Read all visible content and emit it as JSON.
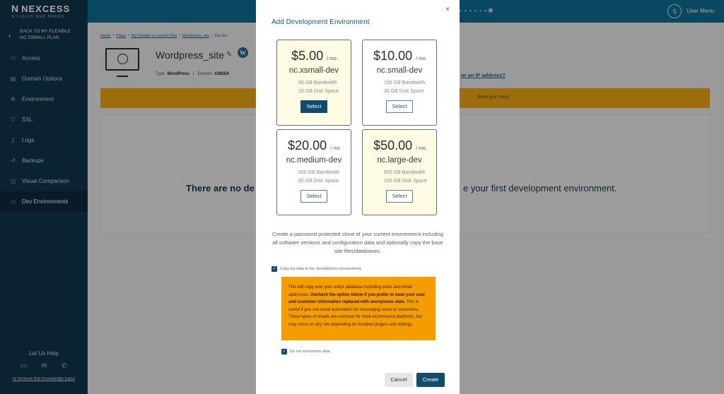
{
  "brand": {
    "name": "NEXCESS",
    "tagline": "A LIQUID WEB BRAND"
  },
  "sidebar": {
    "back_label": "BACK TO MY FLEXIBLE NC.XSMALL PLAN",
    "items": [
      {
        "label": "Access",
        "icon": "person-icon"
      },
      {
        "label": "Domain Options",
        "icon": "document-icon"
      },
      {
        "label": "Environment",
        "icon": "gear-icon"
      },
      {
        "label": "SSL",
        "icon": "shield-icon"
      },
      {
        "label": "Logs",
        "icon": "file-icon"
      },
      {
        "label": "Backups",
        "icon": "database-icon"
      },
      {
        "label": "Visual Comparison",
        "icon": "compare-icon"
      },
      {
        "label": "Dev Environments",
        "icon": "monitor-icon"
      }
    ],
    "help_title": "Let Us Help",
    "help_link": "or browse the knowledge base"
  },
  "topbar": {
    "masked": "• • • • • •",
    "avatar_initial": "S",
    "user_menu": "User Menu"
  },
  "breadcrumb": [
    "Home",
    "Plans",
    "My Flexible nc.xsmall Plan",
    "Wordpress_site",
    "Dev En"
  ],
  "site": {
    "name": "Wordpress_site",
    "type_label": "Type",
    "type_value": "WordPress",
    "domain_label": "Domain",
    "domain_value": "028554",
    "ip_link": "or an IP address?"
  },
  "alert": {
    "text": "finish your setup"
  },
  "empty": {
    "left": "There are no de",
    "right": "e your first development environment."
  },
  "modal": {
    "title": "Add Development Environment",
    "close": "×",
    "plans": [
      {
        "price": "$5.00",
        "unit": "/ mo",
        "name": "nc.xsmall-dev",
        "bandwidth": "50 GB Bandwidth",
        "disk": "10 GB Disk Space",
        "button": "Select"
      },
      {
        "price": "$10.00",
        "unit": "/ mo",
        "name": "nc.small-dev",
        "bandwidth": "150 GB Bandwidth",
        "disk": "30 GB Disk Space",
        "button": "Select"
      },
      {
        "price": "$20.00",
        "unit": "/ mo",
        "name": "nc.medium-dev",
        "bandwidth": "300 GB Bandwidth",
        "disk": "60 GB Disk Space",
        "button": "Select"
      },
      {
        "price": "$50.00",
        "unit": "/ mo",
        "name": "nc.large-dev",
        "bandwidth": "800 GB Bandwidth",
        "disk": "150 GB Disk Space",
        "button": "Select"
      }
    ],
    "description": "Create a password protected clone of your current environment including all software versions and configuration data and optionally copy the base site files/databases.",
    "copy_checkbox_label": "Copy my data to the development environment.",
    "warning_part1": "This will copy over your entire database including users and email addresses. ",
    "warning_bold": "Uncheck the option below if you prefer to have your user and customer information replaced with anonymous data.",
    "warning_part2": " This is useful if you use email automation for messaging users or customers. These types of emails are common for most eCommerce platforms, but may occur on any site depending on installed plugins and settings.",
    "anonymize_checkbox_label": "Do not anonymize data.",
    "cancel": "Cancel",
    "create": "Create"
  }
}
